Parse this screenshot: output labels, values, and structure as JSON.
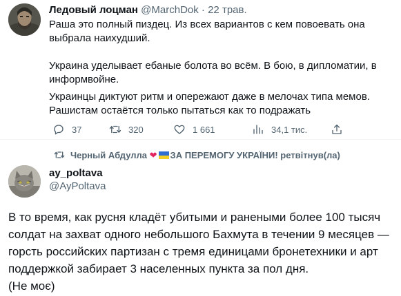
{
  "tweet": {
    "author_name": "Ледовый лоцман",
    "author_handle": "@MarchDok",
    "separator": "·",
    "date": "22 трав.",
    "lines": [
      "Раша это полный пиздец. Из всех вариантов с кем повоевать она",
      "выбрала наихудший.",
      "Украина уделывает ебаные болота во всём. В бою, в дипломатии, в",
      "информвойне.",
      "Украинцы диктуют ритм и опережают даже в мелочах типа мемов.",
      "Рашистам остаётся только пытаться как то подражать"
    ],
    "actions": {
      "reply_icon": "reply-icon",
      "reply_count": "37",
      "retweet_icon": "retweet-icon",
      "retweet_count": "320",
      "like_icon": "heart-icon",
      "like_count": "1 661",
      "views_icon": "views-icon",
      "views_count": "34,1 тис.",
      "share_icon": "share-icon"
    }
  },
  "retweet_banner": {
    "user": "Черный Абдулла",
    "heart": "❤",
    "slogan": "ЗА ПЕРЕМОГУ УКРАЇНИ!",
    "suffix": "ретвітнув(ла)"
  },
  "quote": {
    "author_name": "ay_poltava",
    "author_handle": "@AyPoltava",
    "lines": [
      "В то время, как русня кладёт убитыми и ранеными более 100 тысяч",
      "солдат на захват одного небольшого Бахмута в течении 9 месяцев —",
      "горсть российских партизан с тремя единицами бронетехники и арт",
      "поддержкой забирает 3 населенных пункта за пол дня.",
      "(Не моє)"
    ]
  },
  "colors": {
    "text": "#0f1419",
    "secondary": "#536471",
    "heart": "#e0245e",
    "flag_blue": "#2f6fd1",
    "flag_yellow": "#f4cf24"
  }
}
